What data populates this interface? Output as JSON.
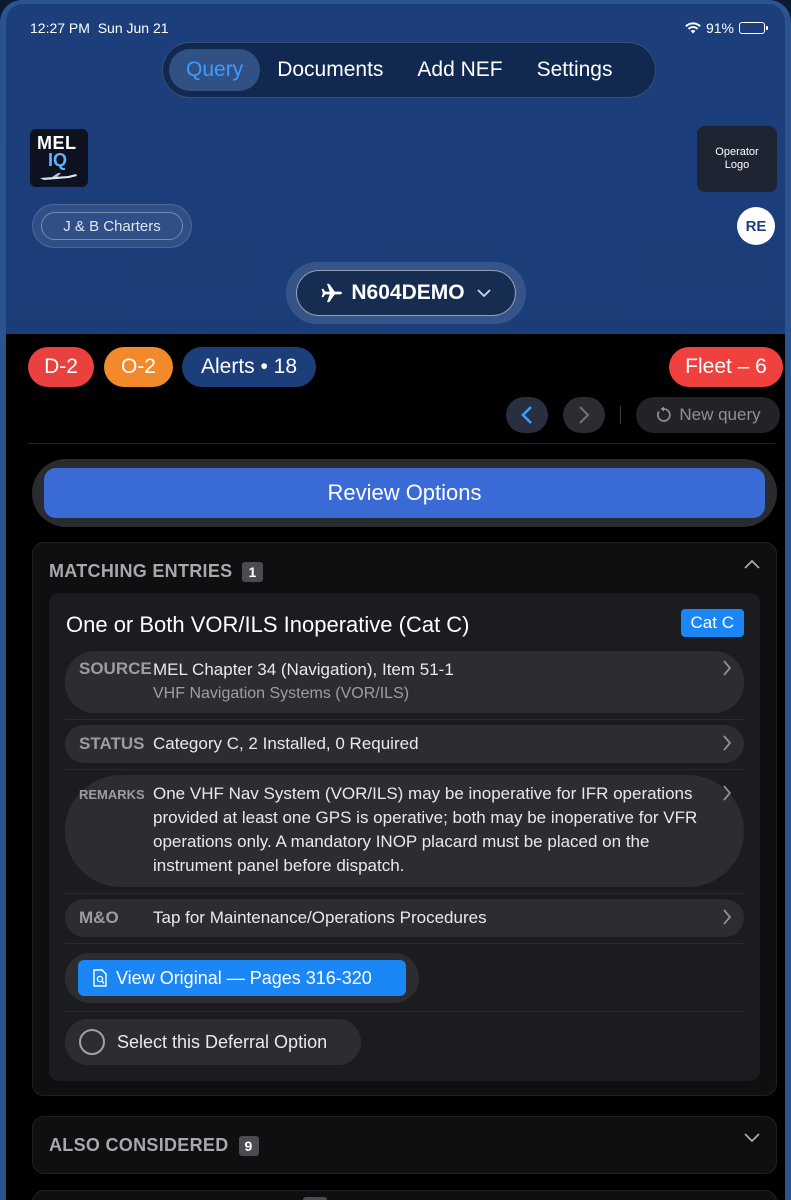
{
  "status_bar": {
    "time": "12:27 PM",
    "date": "Sun Jun 21",
    "battery": "91%",
    "battery_level": 0.91
  },
  "nav": {
    "tabs": [
      {
        "label": "Query",
        "active": true
      },
      {
        "label": "Documents",
        "active": false
      },
      {
        "label": "Add NEF",
        "active": false
      },
      {
        "label": "Settings",
        "active": false
      }
    ]
  },
  "header": {
    "app_logo_line1": "MEL",
    "app_logo_line2": "IQ",
    "operator_logo_text": "Operator Logo",
    "operator_name": "J & B Charters",
    "avatar_initials": "RE",
    "tail_number": "N604DEMO"
  },
  "badges": {
    "d": "D-2",
    "o": "O-2",
    "alerts": "Alerts • 18",
    "fleet": "Fleet – 6"
  },
  "query_nav": {
    "new_query": "New query"
  },
  "review_options": "Review Options",
  "matching": {
    "header": "MATCHING ENTRIES",
    "count": "1",
    "entry": {
      "title": "One or Both VOR/ILS Inoperative (Cat C)",
      "category_chip": "Cat C",
      "source_label": "SOURCE",
      "source_value": "MEL Chapter 34 (Navigation), Item 51-1",
      "source_sub": "VHF Navigation Systems (VOR/ILS)",
      "status_label": "STATUS",
      "status_value": "Category C, 2 Installed, 0 Required",
      "remarks_label": "REMARKS",
      "remarks_value": "One VHF Nav System (VOR/ILS) may be inoperative for IFR operations provided at least one GPS is operative; both may be inoperative for VFR operations only. A mandatory INOP placard must be placed on the instrument panel before dispatch.",
      "mo_label": "M&O",
      "mo_value": "Tap for Maintenance/Operations Procedures",
      "view_original": "View Original — Pages 316-320",
      "select_option": "Select this Deferral Option"
    }
  },
  "also_considered": {
    "header": "ALSO CONSIDERED",
    "count": "9"
  },
  "colors": {
    "accent": "#1b86f5",
    "nav_active": "#3e9bff",
    "danger": "#e8413e",
    "warning": "#f28a2c",
    "header_bg": "#1c3f7c"
  }
}
